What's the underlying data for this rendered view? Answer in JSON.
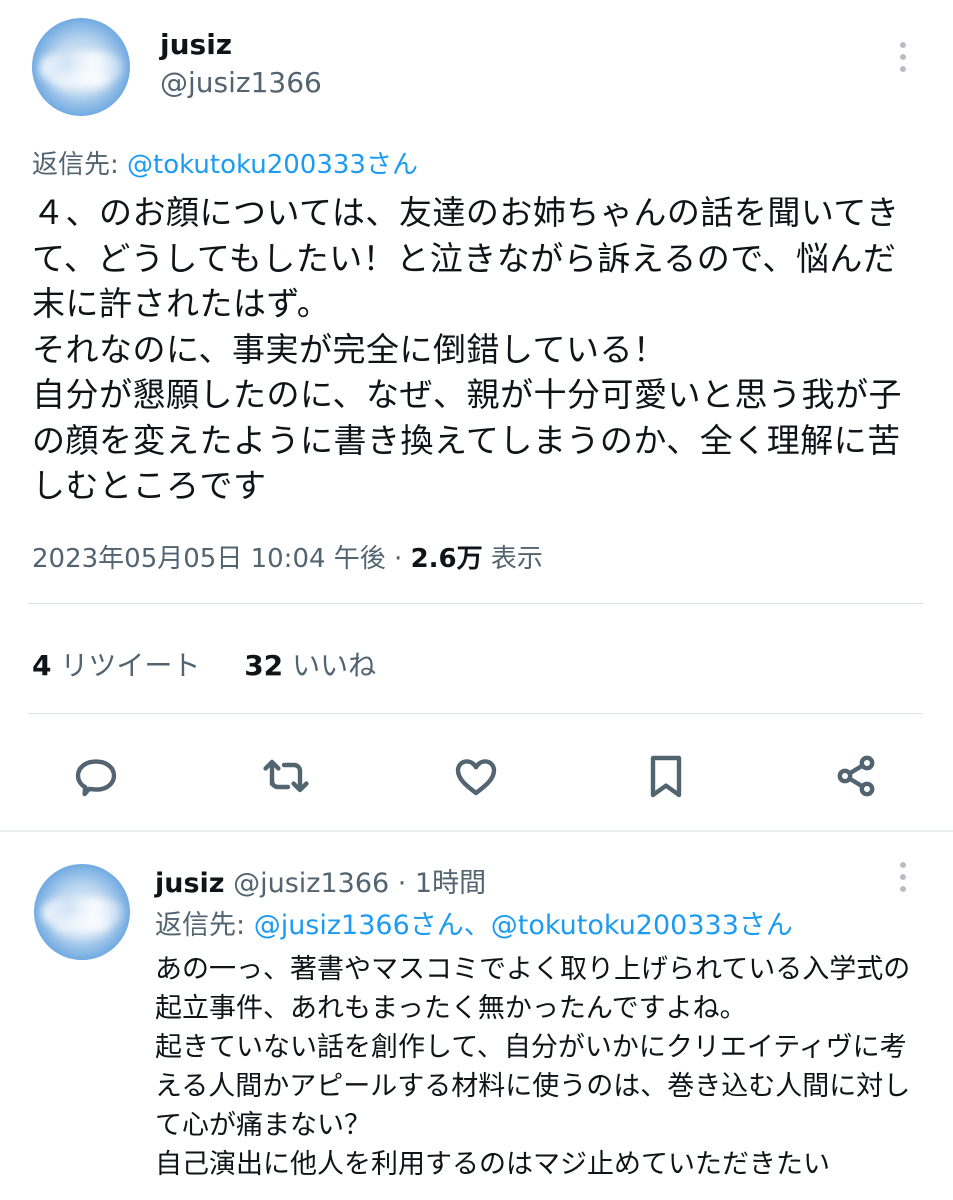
{
  "main_tweet": {
    "name": "jusiz",
    "handle": "@jusiz1366",
    "reply_prefix": "返信先: ",
    "reply_to": "@tokutoku200333さん",
    "body": "４、のお顔については、友達のお姉ちゃんの話を聞いてきて、どうしてもしたい！と泣きながら訴えるので、悩んだ末に許されたはず。\nそれなのに、事実が完全に倒錯している！\n自分が懇願したのに、なぜ、親が十分可愛いと思う我が子の顔を変えたように書き換えてしまうのか、全く理解に苦しむところです",
    "timestamp": "2023年05月05日 10:04 午後",
    "separator": " · ",
    "views_count": "2.6万",
    "views_label": " 表示",
    "retweets_count": "4",
    "retweets_label": " リツイート",
    "likes_count": "32",
    "likes_label": " いいね"
  },
  "actions": {
    "icons": [
      "reply-icon",
      "retweet-icon",
      "like-icon",
      "bookmark-icon",
      "share-icon"
    ]
  },
  "reply_tweet": {
    "name": "jusiz",
    "handle": " @jusiz1366",
    "time": " · 1時間",
    "reply_prefix": "返信先: ",
    "reply_to": "@jusiz1366さん、@tokutoku200333さん",
    "body": "あの一っ、著書やマスコミでよく取り上げられている入学式の起立事件、あれもまったく無かったんですよね。\n起きていない話を創作して、自分がいかにクリエイティヴに考える人間かアピールする材料に使うのは、巻き込む人間に対して心が痛まない？\n自己演出に他人を利用するのはマジ止めていただきたい"
  },
  "colors": {
    "link": "#1d9bf0",
    "muted": "#536471",
    "text": "#0f1419"
  }
}
